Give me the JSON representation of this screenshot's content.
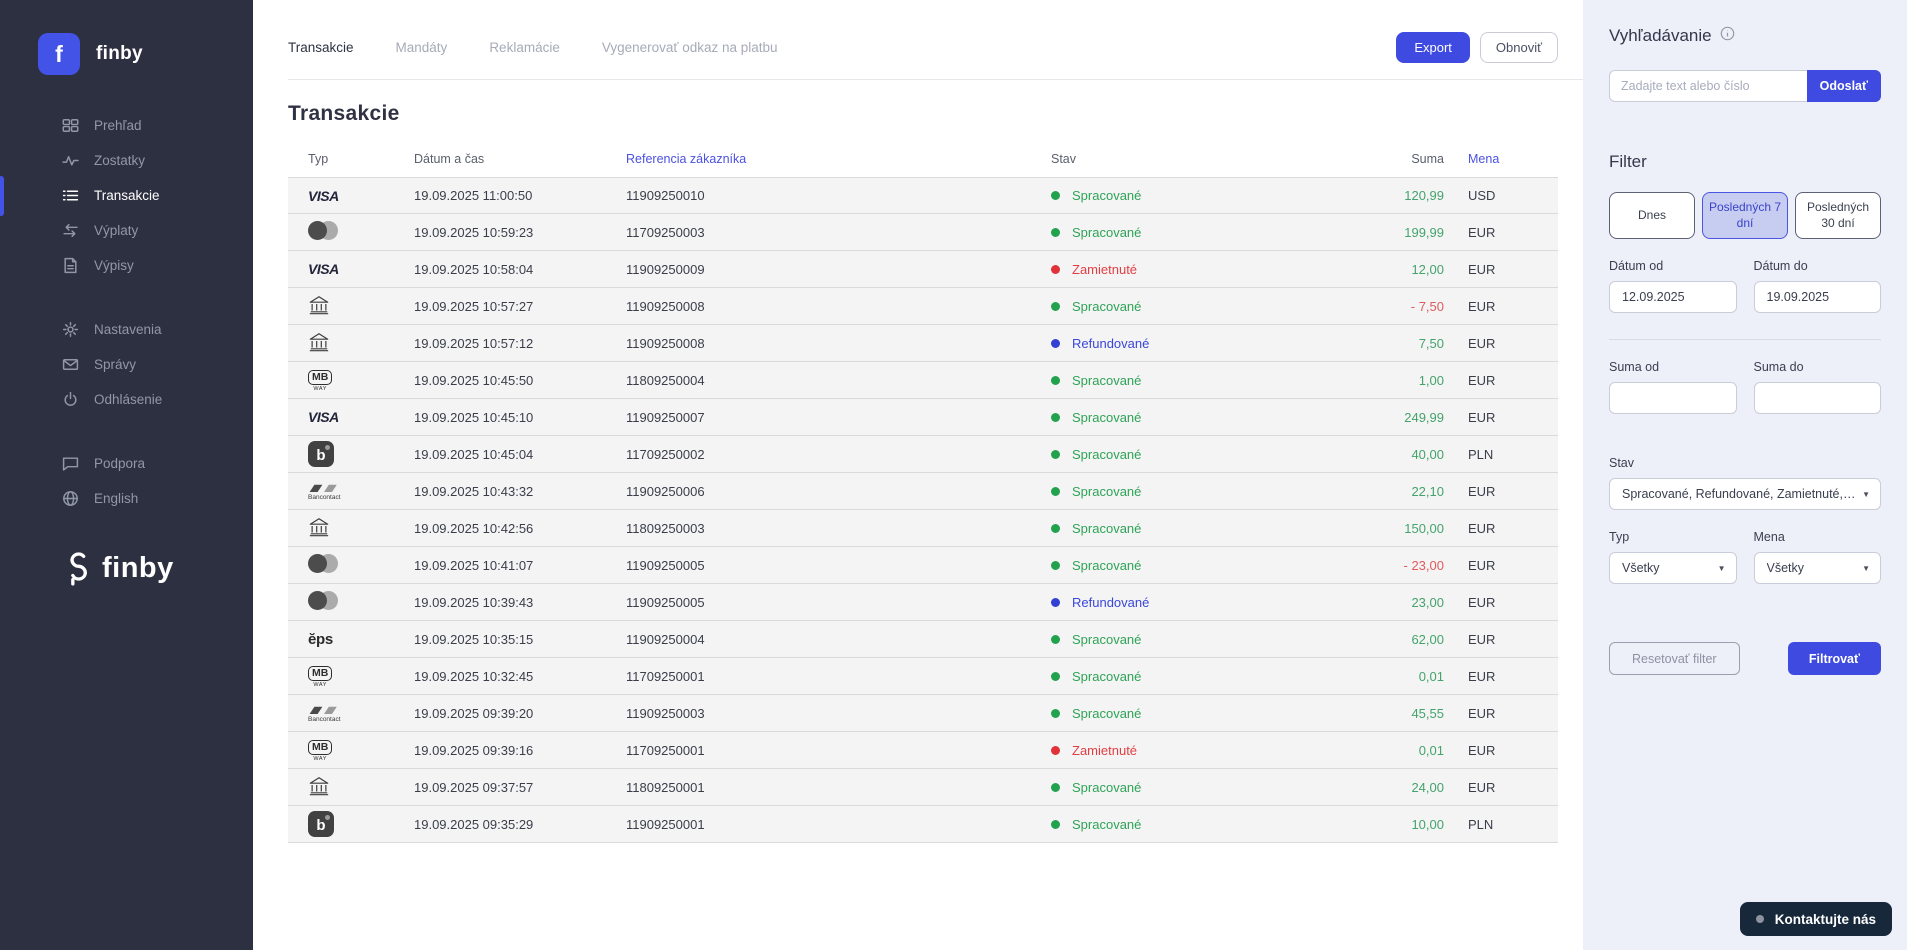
{
  "brand": {
    "name": "finby",
    "logo_letter": "f"
  },
  "sidebar": {
    "groups": [
      [
        {
          "id": "prehlad",
          "label": "Prehľad",
          "icon": "grid-icon"
        },
        {
          "id": "zostatky",
          "label": "Zostatky",
          "icon": "pulse-icon"
        },
        {
          "id": "transakcie",
          "label": "Transakcie",
          "icon": "list-icon",
          "active": true
        },
        {
          "id": "vyplaty",
          "label": "Výplaty",
          "icon": "transfer-arrows-icon"
        },
        {
          "id": "vypisy",
          "label": "Výpisy",
          "icon": "document-icon"
        }
      ],
      [
        {
          "id": "nastavenia",
          "label": "Nastavenia",
          "icon": "gear-icon"
        },
        {
          "id": "spravy",
          "label": "Správy",
          "icon": "envelope-icon"
        },
        {
          "id": "odhlasenie",
          "label": "Odhlásenie",
          "icon": "power-icon"
        }
      ],
      [
        {
          "id": "podpora",
          "label": "Podpora",
          "icon": "chat-icon"
        },
        {
          "id": "english",
          "label": "English",
          "icon": "globe-icon"
        }
      ]
    ]
  },
  "header": {
    "tabs": [
      {
        "label": "Transakcie",
        "active": true
      },
      {
        "label": "Mandáty"
      },
      {
        "label": "Reklamácie"
      },
      {
        "label": "Vygenerovať odkaz na platbu"
      }
    ],
    "export_label": "Export",
    "refresh_label": "Obnoviť"
  },
  "page": {
    "title": "Transakcie"
  },
  "table": {
    "columns": [
      {
        "label": "Typ"
      },
      {
        "label": "Dátum a čas"
      },
      {
        "label": "Referencia zákazníka",
        "link": true
      },
      {
        "label": "Stav"
      },
      {
        "label": "Suma",
        "align": "right"
      },
      {
        "label": "Mena",
        "link": true
      }
    ],
    "rows": [
      {
        "type": "visa",
        "datetime": "19.09.2025 11:00:50",
        "reference": "11909250010",
        "status": "Spracované",
        "amount": "120,99",
        "currency": "USD"
      },
      {
        "type": "mastercard",
        "datetime": "19.09.2025 10:59:23",
        "reference": "11709250003",
        "status": "Spracované",
        "amount": "199,99",
        "currency": "EUR"
      },
      {
        "type": "visa",
        "datetime": "19.09.2025 10:58:04",
        "reference": "11909250009",
        "status": "Zamietnuté",
        "amount": "12,00",
        "currency": "EUR"
      },
      {
        "type": "bank",
        "datetime": "19.09.2025 10:57:27",
        "reference": "11909250008",
        "status": "Spracované",
        "amount": "- 7,50",
        "currency": "EUR"
      },
      {
        "type": "bank",
        "datetime": "19.09.2025 10:57:12",
        "reference": "11909250008",
        "status": "Refundované",
        "amount": "7,50",
        "currency": "EUR"
      },
      {
        "type": "mbway",
        "datetime": "19.09.2025 10:45:50",
        "reference": "11809250004",
        "status": "Spracované",
        "amount": "1,00",
        "currency": "EUR"
      },
      {
        "type": "visa",
        "datetime": "19.09.2025 10:45:10",
        "reference": "11909250007",
        "status": "Spracované",
        "amount": "249,99",
        "currency": "EUR"
      },
      {
        "type": "blik",
        "datetime": "19.09.2025 10:45:04",
        "reference": "11709250002",
        "status": "Spracované",
        "amount": "40,00",
        "currency": "PLN"
      },
      {
        "type": "bancontact",
        "datetime": "19.09.2025 10:43:32",
        "reference": "11909250006",
        "status": "Spracované",
        "amount": "22,10",
        "currency": "EUR"
      },
      {
        "type": "bank",
        "datetime": "19.09.2025 10:42:56",
        "reference": "11809250003",
        "status": "Spracované",
        "amount": "150,00",
        "currency": "EUR"
      },
      {
        "type": "mastercard",
        "datetime": "19.09.2025 10:41:07",
        "reference": "11909250005",
        "status": "Spracované",
        "amount": "- 23,00",
        "currency": "EUR"
      },
      {
        "type": "mastercard",
        "datetime": "19.09.2025 10:39:43",
        "reference": "11909250005",
        "status": "Refundované",
        "amount": "23,00",
        "currency": "EUR"
      },
      {
        "type": "eps",
        "datetime": "19.09.2025 10:35:15",
        "reference": "11909250004",
        "status": "Spracované",
        "amount": "62,00",
        "currency": "EUR"
      },
      {
        "type": "mbway",
        "datetime": "19.09.2025 10:32:45",
        "reference": "11709250001",
        "status": "Spracované",
        "amount": "0,01",
        "currency": "EUR"
      },
      {
        "type": "bancontact",
        "datetime": "19.09.2025 09:39:20",
        "reference": "11909250003",
        "status": "Spracované",
        "amount": "45,55",
        "currency": "EUR"
      },
      {
        "type": "mbway",
        "datetime": "19.09.2025 09:39:16",
        "reference": "11709250001",
        "status": "Zamietnuté",
        "amount": "0,01",
        "currency": "EUR"
      },
      {
        "type": "bank",
        "datetime": "19.09.2025 09:37:57",
        "reference": "11809250001",
        "status": "Spracované",
        "amount": "24,00",
        "currency": "EUR"
      },
      {
        "type": "blik",
        "datetime": "19.09.2025 09:35:29",
        "reference": "11909250001",
        "status": "Spracované",
        "amount": "10,00",
        "currency": "PLN"
      }
    ]
  },
  "search": {
    "title": "Vyhľadávanie",
    "placeholder": "Zadajte text alebo číslo",
    "submit_label": "Odoslať"
  },
  "filter": {
    "title": "Filter",
    "quick": [
      {
        "label": "Dnes"
      },
      {
        "label": "Posledných 7 dní",
        "active": true
      },
      {
        "label": "Posledných 30 dní"
      }
    ],
    "date_from_label": "Dátum od",
    "date_from": "12.09.2025",
    "date_to_label": "Dátum do",
    "date_to": "19.09.2025",
    "sum_from_label": "Suma od",
    "sum_from": "",
    "sum_to_label": "Suma do",
    "sum_to": "",
    "status_label": "Stav",
    "status_value": "Spracované, Refundované, Zamietnuté, ...",
    "type_label": "Typ",
    "type_value": "Všetky",
    "currency_label": "Mena",
    "currency_value": "Všetky",
    "reset_label": "Resetovať filter",
    "apply_label": "Filtrovať"
  },
  "contact": {
    "label": "Kontaktujte nás"
  },
  "colors": {
    "accent": "#3f4ae0",
    "sidebar_bg": "#2d3041",
    "panel_bg": "#eef0f9",
    "status_processed": "#23a24d",
    "status_rejected": "#e03238",
    "status_refunded": "#3340d4",
    "amount_positive": "#44a36b",
    "amount_negative": "#e05b5b",
    "header_link": "#4b51e0"
  }
}
